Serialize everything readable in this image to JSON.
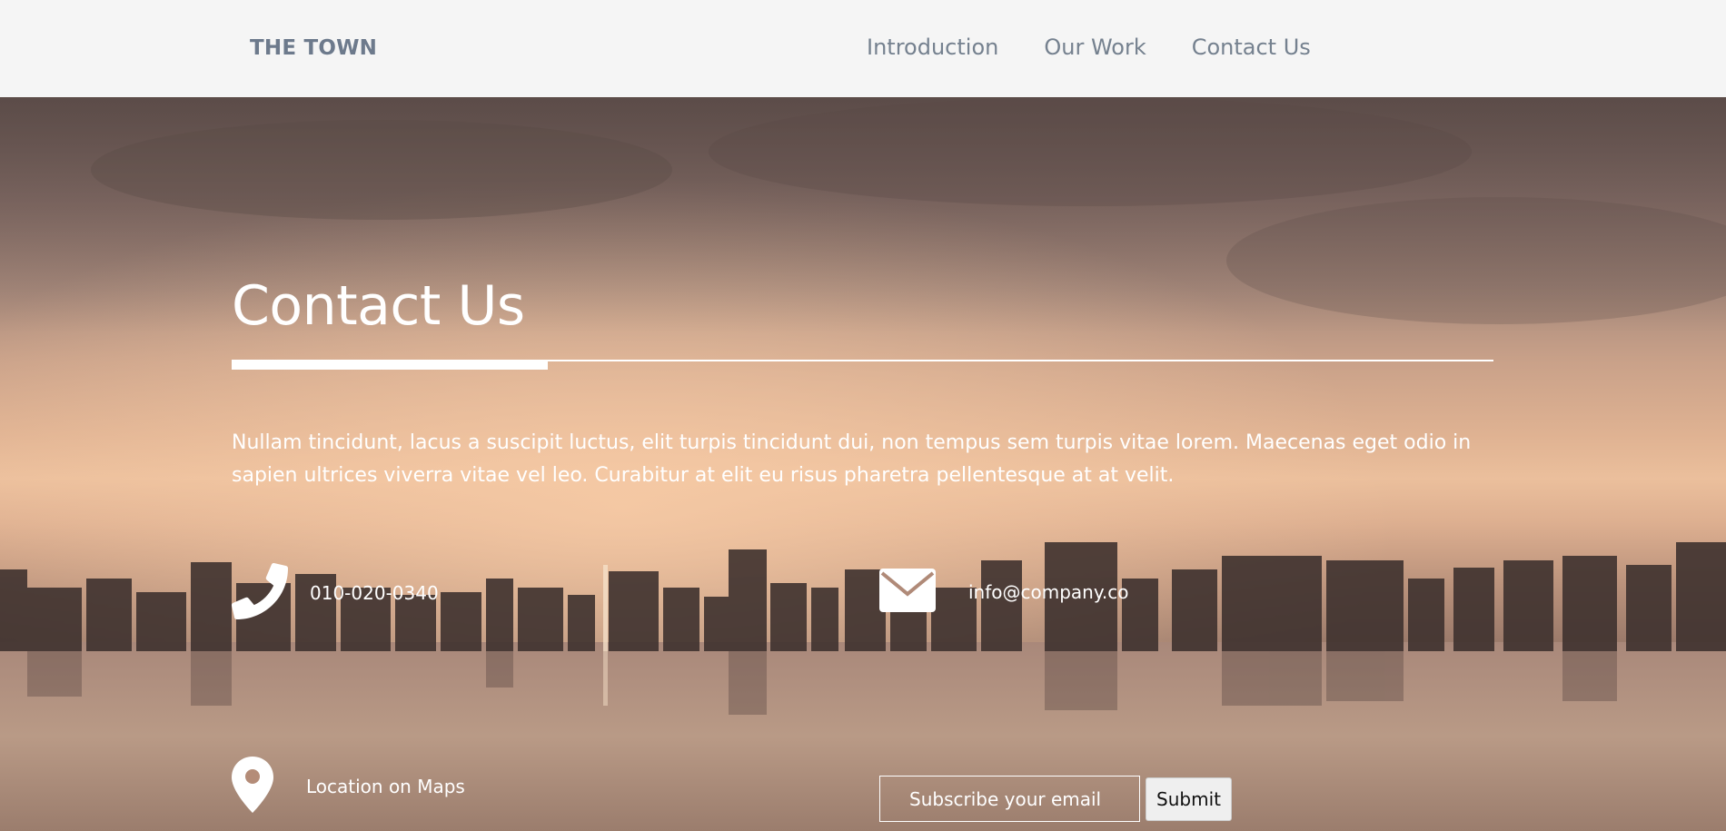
{
  "header": {
    "brand": "THE TOWN",
    "nav": [
      {
        "label": "Introduction"
      },
      {
        "label": "Our Work"
      },
      {
        "label": "Contact Us"
      }
    ]
  },
  "contact": {
    "title": "Contact Us",
    "intro": "Nullam tincidunt, lacus a suscipit luctus, elit turpis tincidunt dui, non tempus sem turpis vitae lorem. Maecenas eget odio in sapien ultrices viverra vitae vel leo. Curabitur at elit eu risus pharetra pellentesque at at velit.",
    "phone": {
      "icon": "phone-icon",
      "text": "010-020-0340"
    },
    "email": {
      "icon": "envelope-icon",
      "text": "info@company.co"
    },
    "location": {
      "icon": "map-pin-icon",
      "text": "Location on Maps"
    },
    "subscribe": {
      "placeholder": "Subscribe your email",
      "button_label": "Submit"
    }
  },
  "colors": {
    "header_bg": "#f5f5f5",
    "brand_text": "#6d7a8c",
    "nav_text": "#75818f",
    "hero_text": "#ffffff"
  }
}
